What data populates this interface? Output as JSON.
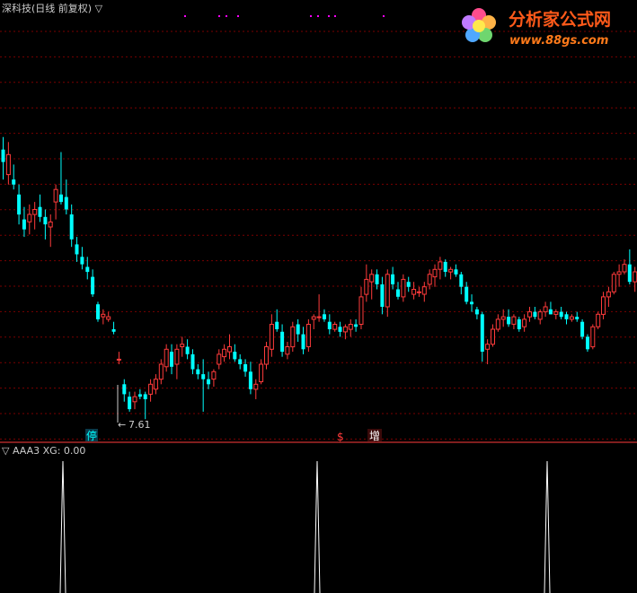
{
  "header": {
    "title": "深科技(日线 前复权) ▽"
  },
  "logo": {
    "name": "分析家公式网",
    "url": "www.88gs.com"
  },
  "colors": {
    "bg": "#000000",
    "up": "#ff3b3b",
    "down": "#00ffff",
    "grid": "#7a0000",
    "text": "#cccccc",
    "divider": "#ff3b3b",
    "pulse": "#ffffff",
    "dots": "#ff00ff"
  },
  "markers": {
    "low_label": "7.61",
    "stop_label": "停",
    "s_label": "$",
    "zeng_label": "增"
  },
  "indicator": {
    "label": "▽ AAA3  XG: 0.00"
  },
  "chart_data": [
    {
      "type": "candlestick",
      "title": "深科技(日线 前复权)",
      "ohlc": [
        [
          14.4,
          14.9,
          13.2,
          13.9
        ],
        [
          13.4,
          14.7,
          13.0,
          14.2
        ],
        [
          13.2,
          13.8,
          12.8,
          13.0
        ],
        [
          12.6,
          13.0,
          11.4,
          11.8
        ],
        [
          11.6,
          12.1,
          10.9,
          11.2
        ],
        [
          11.5,
          12.2,
          11.0,
          11.8
        ],
        [
          11.8,
          12.3,
          11.2,
          12.0
        ],
        [
          12.1,
          12.6,
          11.5,
          11.7
        ],
        [
          11.7,
          12.0,
          10.8,
          11.4
        ],
        [
          11.3,
          11.8,
          10.5,
          11.5
        ],
        [
          12.3,
          13.0,
          11.6,
          12.8
        ],
        [
          12.6,
          14.3,
          12.2,
          12.3
        ],
        [
          12.5,
          13.2,
          11.8,
          12.0
        ],
        [
          11.8,
          12.2,
          10.5,
          10.8
        ],
        [
          10.6,
          10.9,
          9.9,
          10.2
        ],
        [
          10.1,
          10.5,
          9.6,
          9.8
        ],
        [
          9.7,
          10.1,
          9.2,
          9.5
        ],
        [
          9.3,
          9.6,
          8.5,
          8.6
        ],
        [
          8.2,
          8.3,
          7.5,
          7.6
        ],
        [
          7.7,
          8.0,
          7.4,
          7.8
        ],
        [
          7.6,
          7.9,
          7.5,
          7.7
        ],
        [
          7.2,
          7.5,
          7.0,
          7.1
        ],
        [
          6.0,
          6.3,
          5.8,
          6.0
        ],
        [
          5.0,
          5.2,
          4.3,
          4.6
        ],
        [
          4.5,
          4.7,
          3.9,
          4.0
        ],
        [
          4.3,
          4.7,
          4.0,
          4.5
        ],
        [
          4.6,
          4.8,
          4.4,
          4.5
        ],
        [
          4.6,
          4.7,
          3.6,
          4.4
        ],
        [
          4.6,
          5.2,
          4.3,
          5.0
        ],
        [
          4.8,
          5.4,
          4.6,
          5.2
        ],
        [
          5.2,
          6.0,
          5.0,
          5.8
        ],
        [
          5.7,
          6.6,
          5.5,
          6.4
        ],
        [
          6.3,
          6.6,
          5.4,
          5.7
        ],
        [
          5.8,
          6.6,
          5.2,
          6.4
        ],
        [
          6.5,
          6.9,
          6.1,
          6.6
        ],
        [
          6.5,
          6.8,
          6.0,
          6.2
        ],
        [
          6.2,
          6.4,
          5.4,
          5.6
        ],
        [
          5.6,
          5.8,
          5.2,
          5.4
        ],
        [
          5.4,
          6.0,
          3.9,
          5.2
        ],
        [
          5.2,
          5.5,
          4.8,
          5.0
        ],
        [
          5.2,
          5.6,
          4.9,
          5.5
        ],
        [
          5.8,
          6.4,
          5.6,
          6.2
        ],
        [
          6.1,
          6.6,
          5.9,
          6.4
        ],
        [
          6.3,
          7.0,
          6.0,
          6.5
        ],
        [
          6.3,
          6.6,
          5.9,
          6.0
        ],
        [
          6.0,
          6.2,
          5.6,
          5.8
        ],
        [
          5.8,
          6.0,
          5.3,
          5.5
        ],
        [
          5.5,
          5.9,
          4.6,
          4.8
        ],
        [
          4.8,
          5.2,
          4.4,
          5.0
        ],
        [
          5.1,
          6.0,
          5.0,
          5.8
        ],
        [
          5.8,
          6.7,
          5.6,
          6.5
        ],
        [
          6.4,
          7.8,
          6.1,
          7.4
        ],
        [
          7.5,
          8.0,
          7.1,
          7.2
        ],
        [
          7.1,
          7.4,
          6.1,
          6.3
        ],
        [
          6.2,
          6.7,
          6.0,
          6.5
        ],
        [
          6.5,
          7.5,
          6.3,
          7.3
        ],
        [
          7.4,
          7.6,
          6.7,
          7.0
        ],
        [
          7.0,
          7.3,
          6.2,
          6.4
        ],
        [
          6.5,
          7.6,
          6.3,
          7.4
        ],
        [
          7.6,
          7.8,
          7.2,
          7.7
        ],
        [
          7.7,
          8.6,
          7.5,
          7.7
        ],
        [
          7.8,
          8.0,
          7.5,
          7.6
        ],
        [
          7.5,
          7.8,
          7.0,
          7.2
        ],
        [
          7.2,
          7.5,
          7.1,
          7.4
        ],
        [
          7.3,
          7.5,
          6.9,
          7.1
        ],
        [
          7.1,
          7.4,
          6.8,
          7.3
        ],
        [
          7.2,
          7.6,
          6.9,
          7.4
        ],
        [
          7.4,
          7.6,
          7.1,
          7.3
        ],
        [
          7.4,
          8.9,
          7.2,
          8.5
        ],
        [
          8.6,
          9.8,
          8.3,
          9.2
        ],
        [
          9.1,
          9.6,
          8.4,
          9.4
        ],
        [
          9.4,
          9.6,
          8.8,
          9.0
        ],
        [
          9.0,
          9.3,
          7.8,
          8.1
        ],
        [
          8.1,
          9.6,
          7.7,
          9.4
        ],
        [
          9.4,
          9.7,
          8.8,
          9.0
        ],
        [
          8.8,
          9.1,
          8.4,
          8.5
        ],
        [
          8.5,
          9.4,
          8.3,
          9.2
        ],
        [
          9.1,
          9.3,
          8.7,
          8.9
        ],
        [
          8.6,
          9.1,
          8.4,
          8.8
        ],
        [
          8.7,
          8.9,
          8.5,
          8.7
        ],
        [
          8.6,
          9.1,
          8.3,
          8.9
        ],
        [
          9.0,
          9.6,
          8.8,
          9.4
        ],
        [
          9.3,
          9.8,
          8.9,
          9.6
        ],
        [
          9.6,
          10.1,
          9.2,
          9.9
        ],
        [
          9.9,
          10.0,
          9.3,
          9.5
        ],
        [
          9.5,
          9.7,
          9.2,
          9.6
        ],
        [
          9.6,
          9.8,
          9.3,
          9.4
        ],
        [
          9.4,
          9.5,
          8.6,
          8.9
        ],
        [
          8.9,
          9.1,
          8.2,
          8.3
        ],
        [
          8.3,
          8.6,
          7.9,
          8.2
        ],
        [
          8.0,
          8.1,
          7.6,
          7.8
        ],
        [
          7.8,
          7.9,
          5.9,
          6.3
        ],
        [
          6.4,
          6.8,
          5.8,
          6.6
        ],
        [
          6.6,
          7.4,
          6.5,
          7.2
        ],
        [
          7.2,
          7.8,
          7.1,
          7.6
        ],
        [
          7.6,
          8.0,
          7.3,
          7.7
        ],
        [
          7.7,
          8.0,
          7.3,
          7.4
        ],
        [
          7.4,
          7.8,
          7.2,
          7.7
        ],
        [
          7.6,
          7.7,
          7.1,
          7.2
        ],
        [
          7.3,
          7.8,
          7.1,
          7.6
        ],
        [
          7.7,
          8.1,
          7.5,
          7.9
        ],
        [
          7.9,
          8.1,
          7.6,
          7.7
        ],
        [
          7.6,
          8.0,
          7.4,
          7.9
        ],
        [
          7.9,
          8.3,
          7.7,
          8.1
        ],
        [
          8.0,
          8.3,
          7.8,
          7.8
        ],
        [
          7.8,
          8.0,
          7.6,
          7.9
        ],
        [
          7.9,
          8.1,
          7.6,
          7.7
        ],
        [
          7.8,
          7.9,
          7.4,
          7.6
        ],
        [
          7.6,
          7.8,
          7.5,
          7.7
        ],
        [
          7.7,
          7.9,
          7.5,
          7.6
        ],
        [
          7.5,
          7.6,
          6.8,
          6.9
        ],
        [
          6.9,
          7.0,
          6.3,
          6.4
        ],
        [
          6.5,
          7.4,
          6.4,
          7.3
        ],
        [
          7.3,
          7.9,
          7.2,
          7.8
        ],
        [
          7.8,
          8.7,
          7.6,
          8.5
        ],
        [
          8.5,
          8.9,
          8.1,
          8.7
        ],
        [
          8.7,
          9.5,
          8.6,
          9.4
        ],
        [
          9.4,
          9.8,
          8.9,
          9.5
        ],
        [
          9.5,
          10.0,
          9.4,
          9.8
        ],
        [
          9.8,
          10.4,
          9.0,
          9.1
        ],
        [
          9.1,
          9.7,
          8.7,
          9.5
        ],
        [
          9.4,
          10.4,
          9.3,
          10.2
        ],
        [
          10.2,
          11.1,
          10.0,
          10.8
        ],
        [
          10.8,
          11.5,
          10.6,
          11.2
        ]
      ]
    },
    {
      "type": "line",
      "series": [
        {
          "name": "XG",
          "current": 0.0,
          "signal_bars": [
            23,
            115
          ]
        }
      ]
    }
  ]
}
